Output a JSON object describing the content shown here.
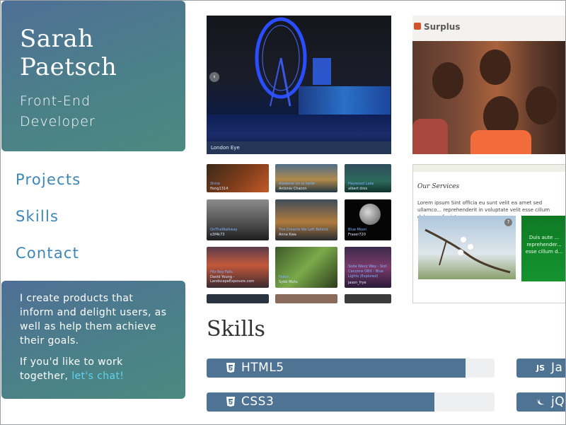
{
  "profile": {
    "first_name": "Sarah",
    "last_name": "Paetsch",
    "role_line1": "Front-End",
    "role_line2": "Developer"
  },
  "nav": {
    "items": [
      {
        "label": "Projects"
      },
      {
        "label": "Skills"
      },
      {
        "label": "Contact"
      }
    ]
  },
  "about": {
    "intro": "I create products that inform and delight users, as well as help them achieve their goals.",
    "cta_prefix": "If you'd like to work together,",
    "cta_link": "let's chat!"
  },
  "project_gallery": {
    "main_caption": "London Eye",
    "thumbnails": [
      {
        "title": "Shine",
        "author": "flong1314"
      },
      {
        "title": "Aiadenar en la tarde",
        "author": "Antonio Chacon"
      },
      {
        "title": "Haywood Lake",
        "author": "albert dros"
      },
      {
        "title": "OnTheWalkway",
        "author": "o3f4k73"
      },
      {
        "title": "The Dreams We Left Behind",
        "author": "Anna Kwa"
      },
      {
        "title": "Blue Moon",
        "author": "Fraser720"
      },
      {
        "title": "Fitz Roy Falls",
        "author": "David Young - LandscapeExposure.com"
      },
      {
        "title": "Fallen",
        "author": "Sybb Mutu"
      },
      {
        "title": "Soda Wavy Way - Slot Canyons OBX - Blue Lights (Explored)",
        "author": "jason_frye"
      }
    ]
  },
  "project_surplus": {
    "logo": "Surplus",
    "services_heading": "Our Services",
    "services_text": "Lorem ipsum Sint officia eu sunt velit ea amet sed ullamco... reprehenderit in voluptate velit esse cillum dolore eu fugiat",
    "green_panel_text": "Duis aute ... reprehender... esse cillum d..."
  },
  "skills": {
    "title": "Skills",
    "items": [
      {
        "name": "HTML5",
        "icon": "html5-icon",
        "level": 0.9
      },
      {
        "name": "CSS3",
        "icon": "css3-icon",
        "level": 0.79
      },
      {
        "name": "Ja",
        "icon_text": "JS",
        "icon": "javascript-icon"
      },
      {
        "name": "jQ",
        "icon": "jquery-icon"
      }
    ]
  },
  "colors": {
    "card_gradient_start": "#4f6f96",
    "card_gradient_end": "#4b8a80",
    "nav_link": "#3d86b5",
    "chat_link": "#5fd3ee",
    "skill_fill": "#4f7393",
    "skill_track": "#eeeff1"
  }
}
